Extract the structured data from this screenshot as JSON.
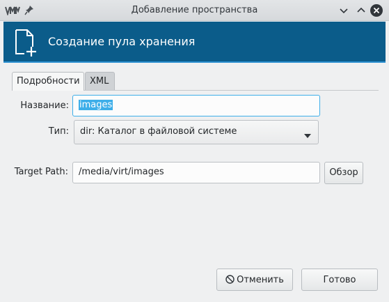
{
  "window": {
    "title": "Добавление пространства",
    "app_icon": "vm-icon",
    "pin_icon": "pin-icon",
    "minimize_icon": "chevron-down-icon",
    "maximize_icon": "chevron-up-icon",
    "close_icon": "close-icon"
  },
  "banner": {
    "icon": "new-document-icon",
    "title": "Создание пула хранения",
    "background": "#0b5c8a"
  },
  "tabs": [
    {
      "label": "Подробности",
      "selected": true
    },
    {
      "label": "XML",
      "selected": false
    }
  ],
  "form": {
    "name_label": "Название:",
    "name_value": "images",
    "type_label": "Тип:",
    "type_value": "dir: Каталог в файловой системе",
    "path_label": "Target Path:",
    "path_value": "/media/virt/images",
    "browse_label": "Обзор"
  },
  "buttons": {
    "cancel_label": "Отменить",
    "cancel_icon": "cancel-icon",
    "ok_label": "Готово"
  },
  "colors": {
    "accent": "#3daee9",
    "banner": "#0b5c8a"
  }
}
